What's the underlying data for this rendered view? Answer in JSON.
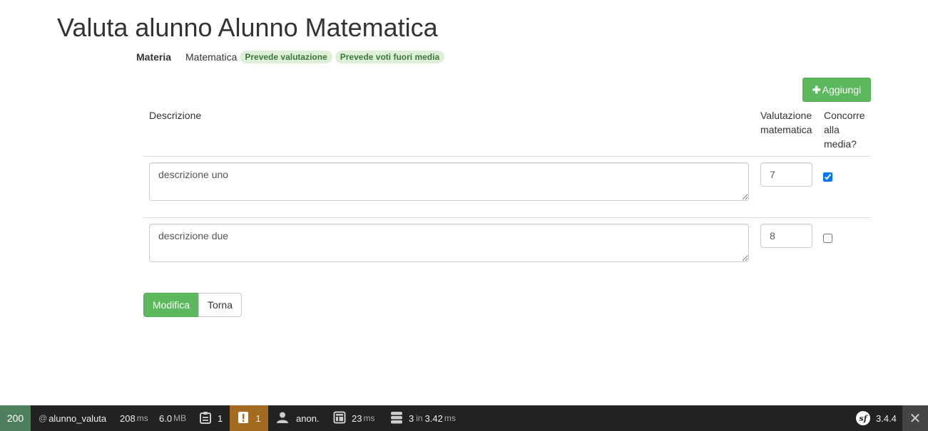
{
  "header": {
    "title": "Valuta alunno Alunno Matematica"
  },
  "subject": {
    "label": "Materia",
    "value": "Matematica",
    "badges": [
      "Prevede valutazione",
      "Prevede voti fuori media"
    ]
  },
  "actions": {
    "add_label": "Aggiungi",
    "add_icon": "plus-icon"
  },
  "table": {
    "columns": [
      "Descrizione",
      "Valutazione matematica",
      "Concorre alla media?"
    ],
    "rows": [
      {
        "description": "descrizione uno",
        "grade": "7",
        "counts_in_average": true
      },
      {
        "description": "descrizione due",
        "grade": "8",
        "counts_in_average": false
      }
    ]
  },
  "form_buttons": {
    "submit_label": "Modifica",
    "back_label": "Torna"
  },
  "toolbar": {
    "status_code": "200",
    "route": "alunno_valuta",
    "time": "208",
    "time_unit": "ms",
    "memory": "6.0",
    "memory_unit": "MB",
    "forms_count": "1",
    "warnings_count": "1",
    "user": "anon.",
    "render_time": "23",
    "render_unit": "ms",
    "db_queries": "3",
    "db_in": "in",
    "db_time": "3.42",
    "db_unit": "ms",
    "version": "3.4.4"
  },
  "colors": {
    "success": "#5cb85c",
    "badge_bg": "#dff0d8",
    "badge_text": "#3c763d",
    "toolbar_bg": "#222222",
    "status_ok": "#4f805d",
    "warning": "#a46a1f"
  }
}
